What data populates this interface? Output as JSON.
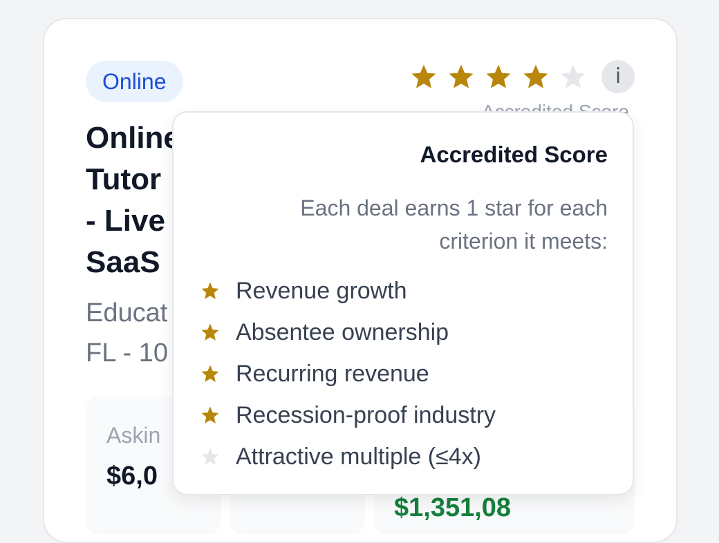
{
  "listing": {
    "badge": "Online",
    "rating": {
      "value": 4,
      "max": 5
    },
    "score_caption": "Accredited Score",
    "title_lines": [
      "Online",
      "Tutor",
      "- Live",
      "SaaS"
    ],
    "subtitle_lines": [
      "Educat",
      "FL - 10"
    ],
    "stats": [
      {
        "label": "Askin",
        "value": "$6,0"
      },
      {
        "label": "",
        "value": ""
      },
      {
        "label": "",
        "value": "$1,351,08"
      }
    ]
  },
  "tooltip": {
    "title": "Accredited Score",
    "description": "Each deal earns 1 star for each criterion it meets:",
    "criteria": [
      {
        "label": "Revenue growth",
        "met": true
      },
      {
        "label": "Absentee ownership",
        "met": true
      },
      {
        "label": "Recurring revenue",
        "met": true
      },
      {
        "label": "Recession-proof industry",
        "met": true
      },
      {
        "label": "Attractive multiple (≤4x)",
        "met": false
      }
    ]
  },
  "icons": {
    "info": "i",
    "star": "star-icon"
  },
  "colors": {
    "star_filled": "#b8860b",
    "star_empty": "#e5e7eb",
    "badge_bg": "#eaf2fe",
    "badge_text": "#1d4ed8",
    "positive_value": "#15803d"
  }
}
